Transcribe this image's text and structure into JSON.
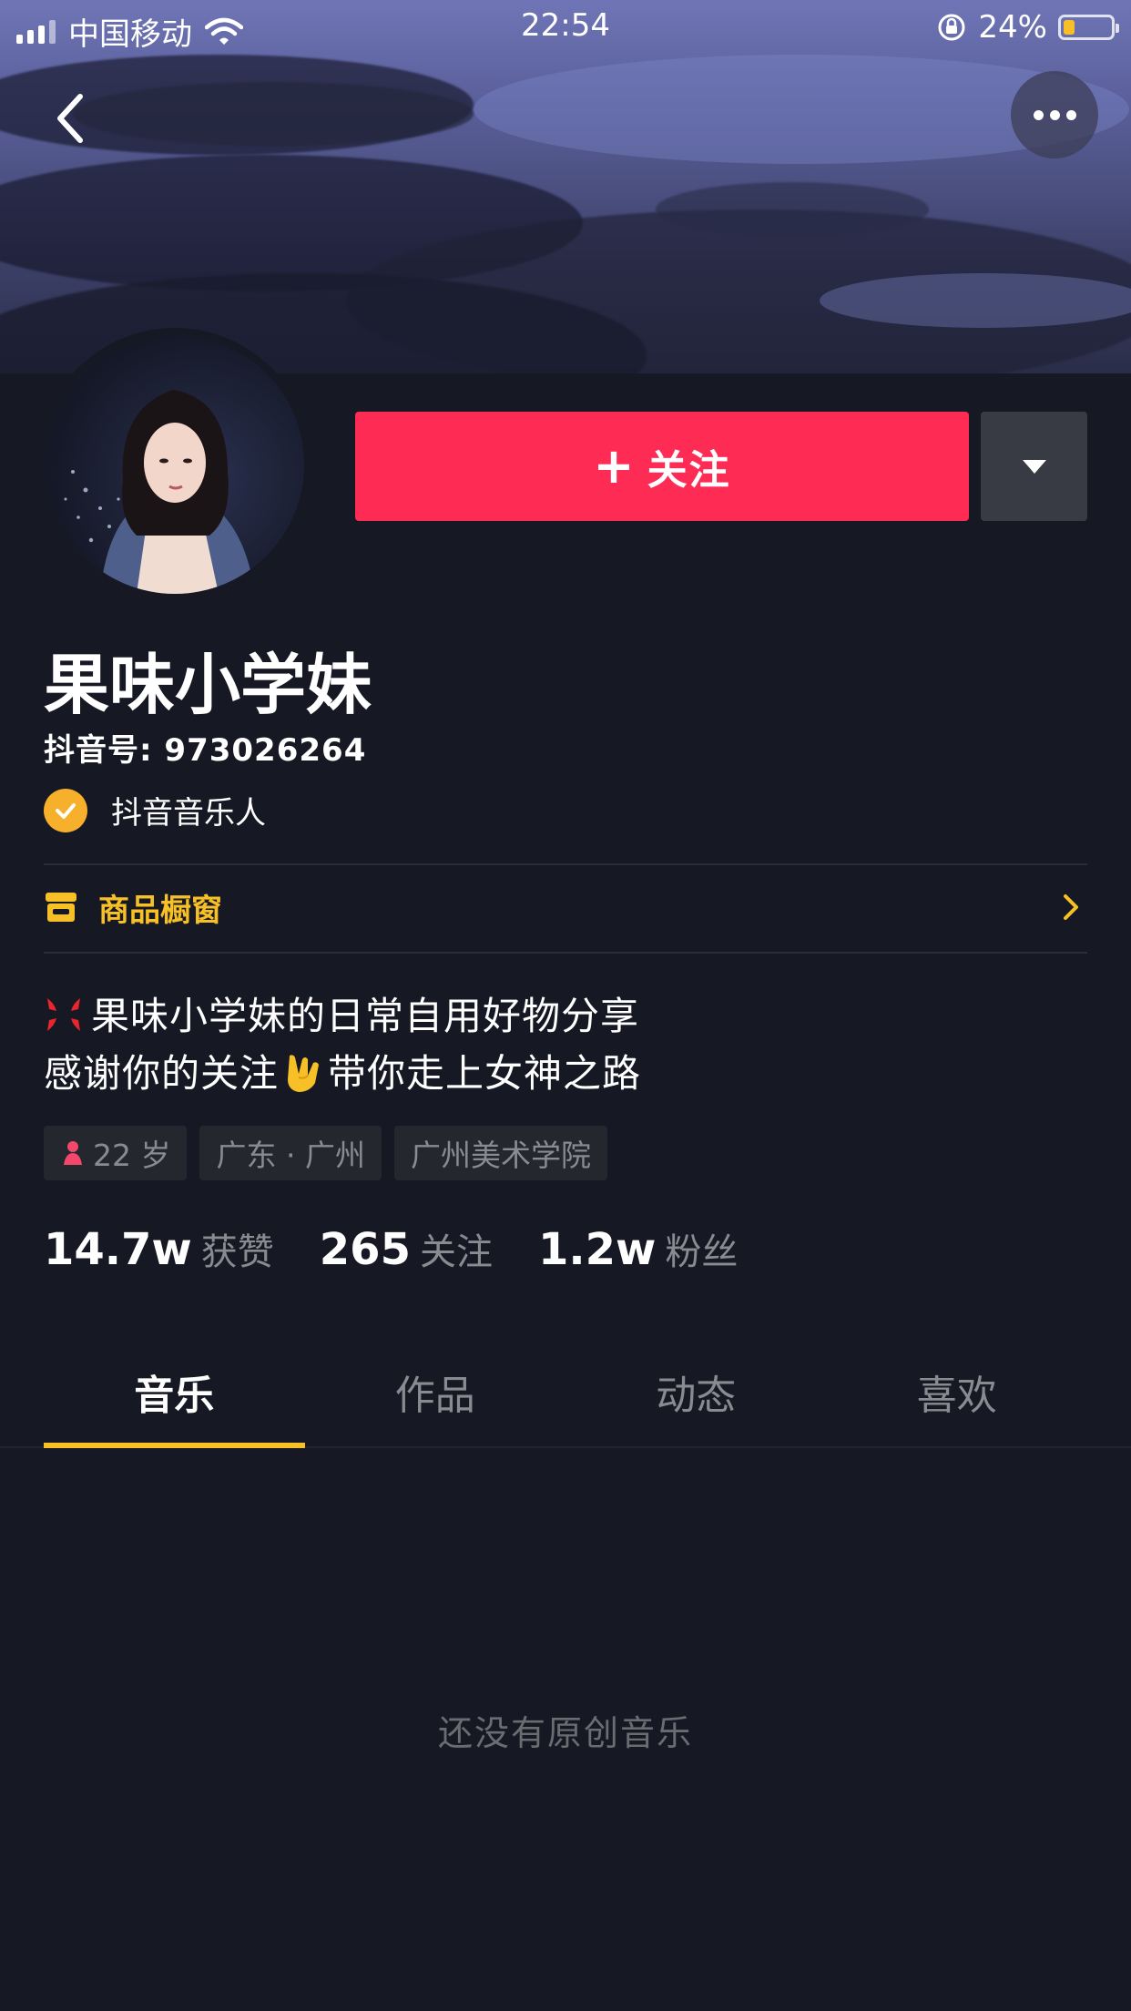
{
  "status_bar": {
    "carrier": "中国移动",
    "time": "22:54",
    "battery": "24%",
    "battery_level": 0.24
  },
  "profile": {
    "follow_label": "关注",
    "name": "果味小学妹",
    "douyin_id": "抖音号: 973026264",
    "badge": "抖音音乐人",
    "shop_label": "商品橱窗",
    "bio_line1": "果味小学妹的日常自用好物分享",
    "bio_line2_a": "感谢你的关注",
    "bio_line2_b": "带你走上女神之路",
    "tags": {
      "age": "22 岁",
      "location": "广东 · 广州",
      "school": "广州美术学院"
    }
  },
  "stats": {
    "likes_num": "14.7w",
    "likes_label": "获赞",
    "following_num": "265",
    "following_label": "关注",
    "fans_num": "1.2w",
    "fans_label": "粉丝"
  },
  "tabs": [
    "音乐",
    "作品",
    "动态",
    "喜欢"
  ],
  "empty_text": "还没有原创音乐",
  "colors": {
    "background": "#161823",
    "follow": "#fe2c55",
    "accent": "#f6c026"
  }
}
